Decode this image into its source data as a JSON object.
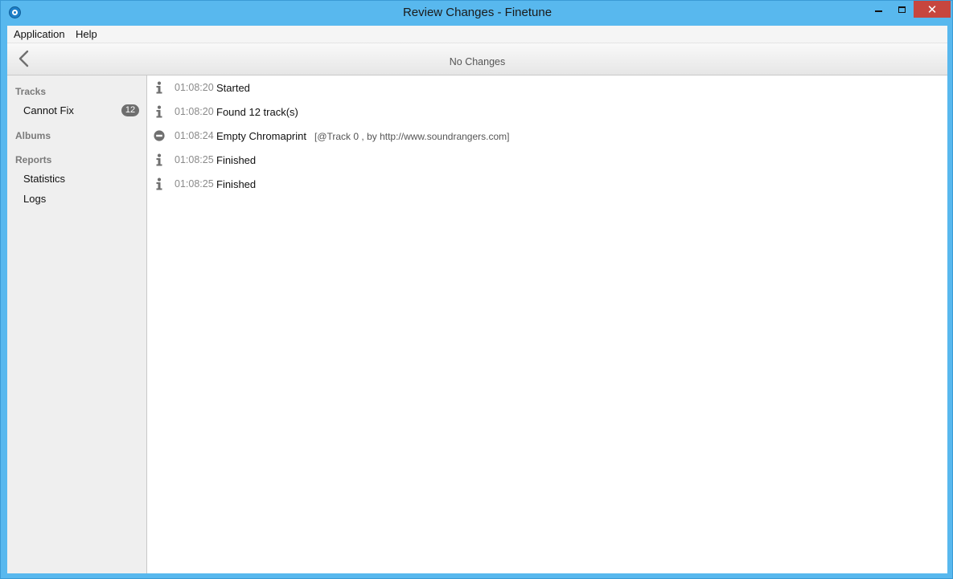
{
  "window": {
    "title": "Review Changes - Finetune",
    "close_glyph": "✕"
  },
  "menu": {
    "items": [
      {
        "label": "Application"
      },
      {
        "label": "Help"
      }
    ]
  },
  "toolbar": {
    "title": "No Changes",
    "back_icon": "chevron-left-icon"
  },
  "sidebar": {
    "sections": {
      "tracks": {
        "heading": "Tracks",
        "items": [
          {
            "label": "Cannot Fix",
            "badge": "12"
          }
        ]
      },
      "albums": {
        "heading": "Albums"
      },
      "reports": {
        "heading": "Reports",
        "items": [
          {
            "label": "Statistics"
          },
          {
            "label": "Logs"
          }
        ]
      }
    }
  },
  "log": {
    "entries": [
      {
        "icon": "info-icon",
        "time": "01:08:20",
        "message": "Started",
        "detail": ""
      },
      {
        "icon": "info-icon",
        "time": "01:08:20",
        "message": "Found 12 track(s)",
        "detail": ""
      },
      {
        "icon": "error-icon",
        "time": "01:08:24",
        "message": "Empty Chromaprint",
        "detail": "[@Track 0 ,  by http://www.soundrangers.com]"
      },
      {
        "icon": "info-icon",
        "time": "01:08:25",
        "message": "Finished",
        "detail": ""
      },
      {
        "icon": "info-icon",
        "time": "01:08:25",
        "message": "Finished",
        "detail": ""
      }
    ]
  },
  "colors": {
    "window_frame": "#58b8ee",
    "close_button": "#c7463e",
    "badge": "#6e6e6e"
  }
}
